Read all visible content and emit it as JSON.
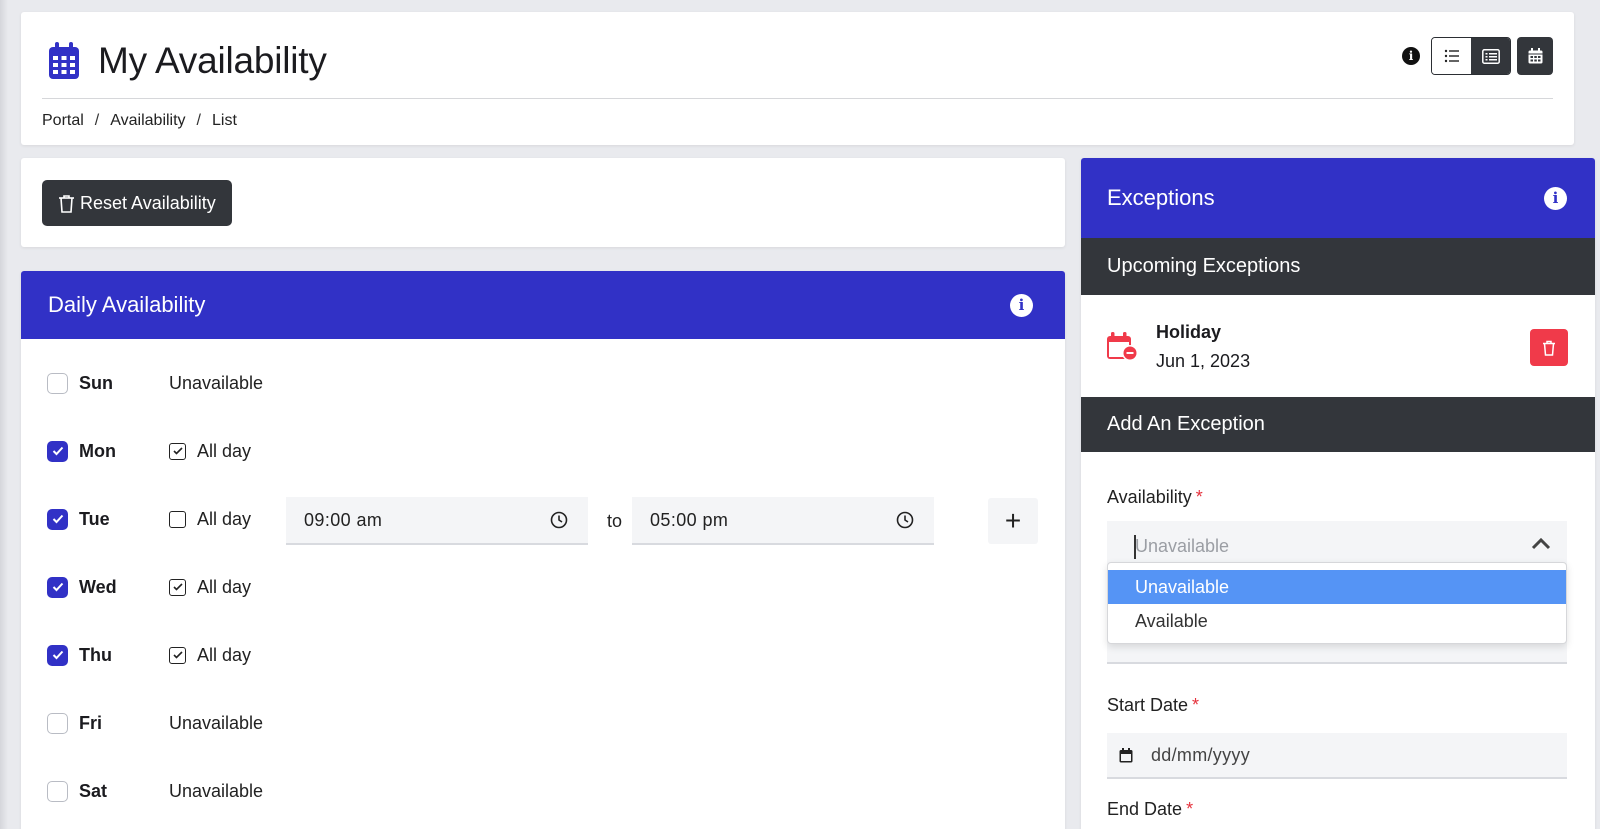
{
  "header": {
    "title": "My Availability",
    "breadcrumb": [
      "Portal",
      "Availability",
      "List"
    ],
    "info_icon": "info-icon",
    "view_buttons": [
      "list-view-icon",
      "detail-view-icon",
      "calendar-view-icon"
    ]
  },
  "toolbar": {
    "reset_label": "Reset Availability"
  },
  "daily": {
    "title": "Daily Availability",
    "days": [
      {
        "label": "Sun",
        "checked": false,
        "status": "Unavailable"
      },
      {
        "label": "Mon",
        "checked": true,
        "status": "All day",
        "all_day": true
      },
      {
        "label": "Tue",
        "checked": true,
        "status": "All day",
        "all_day": false
      },
      {
        "label": "Wed",
        "checked": true,
        "status": "All day",
        "all_day": true
      },
      {
        "label": "Thu",
        "checked": true,
        "status": "All day",
        "all_day": true
      },
      {
        "label": "Fri",
        "checked": false,
        "status": "Unavailable"
      },
      {
        "label": "Sat",
        "checked": false,
        "status": "Unavailable"
      }
    ],
    "tue_start": "09:00 am",
    "tue_to": "to",
    "tue_end": "05:00 pm",
    "add_label": "+"
  },
  "exceptions": {
    "title": "Exceptions",
    "upcoming_title": "Upcoming Exceptions",
    "items": [
      {
        "name": "Holiday",
        "date": "Jun 1, 2023"
      }
    ],
    "add_title": "Add An Exception",
    "availability_label": "Availability",
    "required_mark": "*",
    "availability_placeholder": "Unavailable",
    "options": [
      "Unavailable",
      "Available"
    ],
    "start_date_label": "Start Date",
    "date_placeholder": "dd/mm/yyyy",
    "end_date_label": "End Date"
  },
  "colors": {
    "brand": "#3131c6",
    "dark": "#33363b",
    "danger": "#f03a4a",
    "highlight": "#5594f5"
  }
}
